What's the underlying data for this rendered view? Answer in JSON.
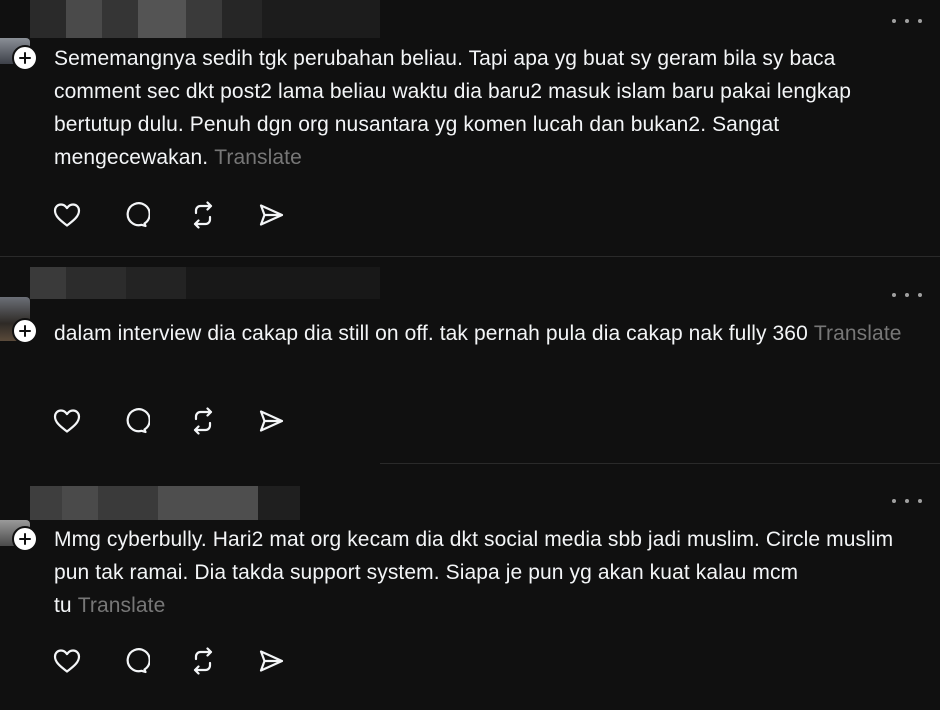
{
  "posts": [
    {
      "text": "Sememangnya sedih tgk perubahan beliau. Tapi apa yg buat sy geram bila sy baca comment sec dkt post2 lama beliau waktu dia baru2 masuk islam baru pakai lengkap bertutup dulu. Penuh dgn org nusantara yg komen lucah dan bukan2. Sangat mengecewakan.",
      "translate": "Translate"
    },
    {
      "text": "dalam interview dia cakap dia still on off. tak pernah pula dia cakap nak fully 360",
      "translate": "Translate"
    },
    {
      "text": "Mmg cyberbully. Hari2 mat org kecam dia dkt social media sbb jadi muslim. Circle muslim pun tak ramai. Dia takda support system. Siapa je pun yg akan kuat kalau mcm tu",
      "translate": "Translate"
    }
  ],
  "icons": {
    "like": "heart-icon",
    "reply": "comment-icon",
    "repost": "repost-icon",
    "share": "send-icon",
    "more": "more-icon",
    "follow": "plus-icon"
  },
  "colors": {
    "background": "#101010",
    "text": "#f3f5f7",
    "translate": "#777777",
    "divider": "#2a2a2a"
  }
}
